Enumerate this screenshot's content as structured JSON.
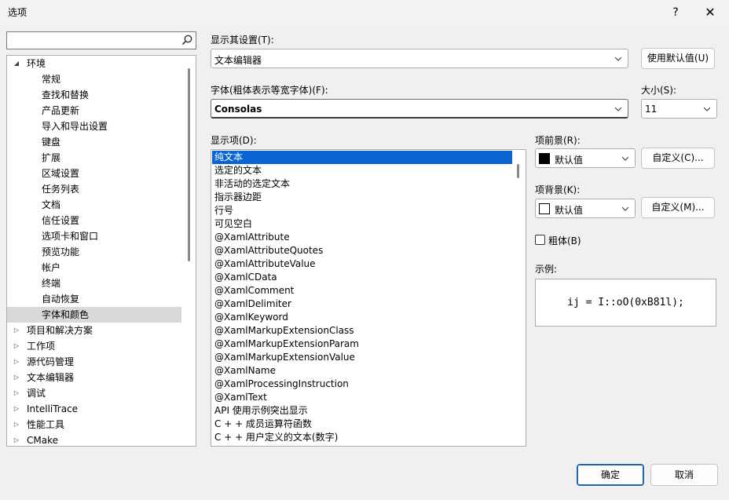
{
  "window": {
    "title": "选项",
    "help": "?",
    "close": "✕"
  },
  "search": {
    "placeholder": "",
    "value": ""
  },
  "tree": {
    "items": [
      {
        "label": "环境",
        "arrow": "◢"
      },
      {
        "label": "常规"
      },
      {
        "label": "查找和替换"
      },
      {
        "label": "产品更新"
      },
      {
        "label": "导入和导出设置"
      },
      {
        "label": "键盘"
      },
      {
        "label": "扩展"
      },
      {
        "label": "区域设置"
      },
      {
        "label": "任务列表"
      },
      {
        "label": "文档"
      },
      {
        "label": "信任设置"
      },
      {
        "label": "选项卡和窗口"
      },
      {
        "label": "预览功能"
      },
      {
        "label": "帐户"
      },
      {
        "label": "终端"
      },
      {
        "label": "自动恢复"
      },
      {
        "label": "字体和颜色"
      },
      {
        "label": "项目和解决方案",
        "arrow": "▷"
      },
      {
        "label": "工作项",
        "arrow": "▷"
      },
      {
        "label": "源代码管理",
        "arrow": "▷"
      },
      {
        "label": "文本编辑器",
        "arrow": "▷"
      },
      {
        "label": "调试",
        "arrow": "▷"
      },
      {
        "label": "IntelliTrace",
        "arrow": "▷"
      },
      {
        "label": "性能工具",
        "arrow": "▷"
      },
      {
        "label": "CMake",
        "arrow": "▷"
      }
    ]
  },
  "settings": {
    "show_settings_for_label": "显示其设置(T):",
    "show_settings_for_value": "文本编辑器",
    "use_defaults_button": "使用默认值(U)",
    "font_label": "字体(粗体表示等宽字体)(F):",
    "font_value": "Consolas",
    "size_label": "大小(S):",
    "size_value": "11",
    "display_items_label": "显示项(D):",
    "foreground_label": "项前景(R):",
    "foreground_value": "默认值",
    "foreground_custom_button": "自定义(C)...",
    "background_label": "项背景(K):",
    "background_value": "默认值",
    "background_custom_button": "自定义(M)...",
    "bold_label": "粗体(B)",
    "sample_label": "示例:",
    "sample_text": "ij = I::oO(0xB81l);"
  },
  "display_items": [
    "纯文本",
    "选定的文本",
    "非活动的选定文本",
    "指示器边距",
    "行号",
    "可见空白",
    "@XamlAttribute",
    "@XamlAttributeQuotes",
    "@XamlAttributeValue",
    "@XamlCData",
    "@XamlComment",
    "@XamlDelimiter",
    "@XamlKeyword",
    "@XamlMarkupExtensionClass",
    "@XamlMarkupExtensionParam",
    "@XamlMarkupExtensionValue",
    "@XamlName",
    "@XamlProcessingInstruction",
    "@XamlText",
    "API 使用示例突出显示",
    "C + + 成员运算符函数",
    "C + + 用户定义的文本(数字)"
  ],
  "footer": {
    "ok_button": "确定",
    "cancel_button": "取消"
  },
  "colors": {
    "selection": "#0a64d2",
    "tree_selection": "#d9d9d9",
    "foreground_swatch": "#000000",
    "background_swatch": "#ffffff"
  }
}
